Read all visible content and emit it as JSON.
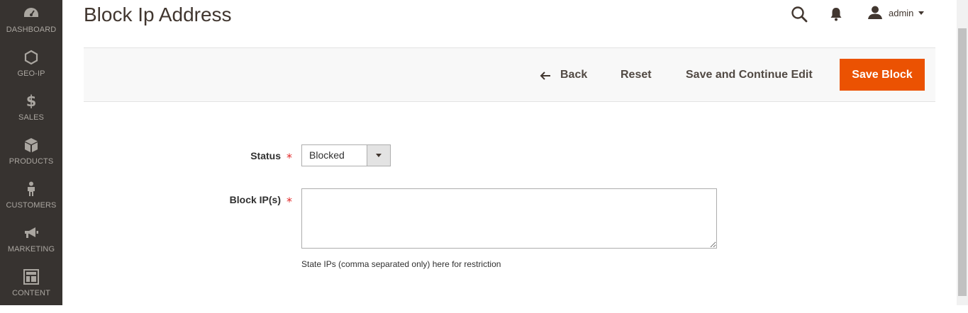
{
  "sidebar": {
    "items": [
      {
        "label": "DASHBOARD",
        "icon": "dashboard-icon"
      },
      {
        "label": "GEO-IP",
        "icon": "hexagon-icon"
      },
      {
        "label": "SALES",
        "icon": "dollar-icon"
      },
      {
        "label": "PRODUCTS",
        "icon": "box-icon"
      },
      {
        "label": "CUSTOMERS",
        "icon": "person-icon"
      },
      {
        "label": "MARKETING",
        "icon": "megaphone-icon"
      },
      {
        "label": "CONTENT",
        "icon": "layout-icon"
      }
    ]
  },
  "header": {
    "title": "Block Ip Address",
    "user_name": "admin"
  },
  "actions": {
    "back_label": "Back",
    "reset_label": "Reset",
    "save_continue_label": "Save and Continue Edit",
    "save_block_label": "Save Block"
  },
  "form": {
    "status_label": "Status",
    "status_value": "Blocked",
    "required_mark": "*",
    "block_ips_label": "Block IP(s)",
    "block_ips_value": "",
    "block_ips_note": "State IPs (comma separated only) here for restriction"
  },
  "colors": {
    "sidebar_bg": "#373330",
    "primary_button": "#eb5202",
    "required": "#e22626"
  }
}
